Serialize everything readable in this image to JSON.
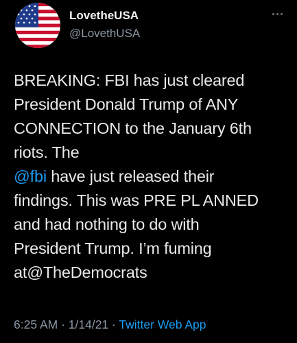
{
  "author": {
    "display_name": "LovetheUSA",
    "handle": "@LovethUSA",
    "avatar_icon": "us-flag-icon"
  },
  "more_icon": "more-options-icon",
  "tweet": {
    "line1": "BREAKING: FBI has just cleared",
    "line2": "President Donald Trump of ANY",
    "line3": "CONNECTION to the January 6th",
    "line4": "riots. The",
    "line5_mention": "@fbi",
    "line5_rest": " have just released their",
    "line6": "findings. This was PRE PL ANNED",
    "line7": "and had nothing to do with",
    "line8": "President Trump. I’m fuming",
    "line9": "at@TheDemocrats"
  },
  "meta": {
    "time": "6:25 AM",
    "sep1": " · ",
    "date": "1/14/21",
    "sep2": " · ",
    "source": "Twitter Web App"
  },
  "colors": {
    "background": "#000000",
    "text": "#e7e9ea",
    "secondary": "#8b98a5",
    "link": "#1d9bf0"
  }
}
